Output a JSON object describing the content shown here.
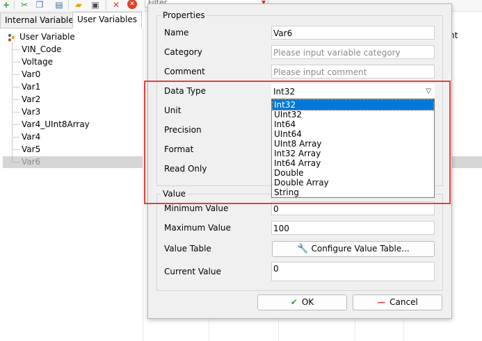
{
  "toolbar": {
    "icons": [
      "add-icon",
      "cut-icon",
      "copy-icon",
      "paste-icon",
      "open-folder-icon",
      "save-icon",
      "delete-icon",
      "stop-icon"
    ],
    "filter_placeholder": "Filter"
  },
  "tabs": [
    {
      "label": "Internal Variables",
      "active": false
    },
    {
      "label": "User Variables",
      "active": true
    }
  ],
  "tree": {
    "root": "User Variable",
    "items": [
      "VIN_Code",
      "Voltage",
      "Var0",
      "Var1",
      "Var2",
      "Var3",
      "Var4_UInt8Array",
      "Var4",
      "Var5",
      "Var6"
    ],
    "selected": "Var6"
  },
  "grid": {
    "header_partial": "nt"
  },
  "dialog": {
    "properties_title": "Properties",
    "name_label": "Name",
    "name_value": "Var6",
    "category_label": "Category",
    "category_placeholder": "Please input variable category",
    "comment_label": "Comment",
    "comment_placeholder": "Please input comment",
    "datatype_label": "Data Type",
    "datatype_value": "Int32",
    "unit_label": "Unit",
    "precision_label": "Precision",
    "format_label": "Format",
    "readonly_label": "Read Only",
    "value_title": "Value",
    "min_label": "Minimum Value",
    "min_value": "0",
    "max_label": "Maximum Value",
    "max_value": "100",
    "valuetable_label": "Value Table",
    "configure_button": "Configure Value Table...",
    "current_label": "Current Value",
    "current_value": "0",
    "ok_button": "OK",
    "cancel_button": "Cancel"
  },
  "dropdown": {
    "options": [
      "Int32",
      "UInt32",
      "Int64",
      "UInt64",
      "UInt8 Array",
      "Int32 Array",
      "Int64 Array",
      "Double",
      "Double Array",
      "String"
    ],
    "highlighted": "Int32"
  },
  "colors": {
    "highlight": "#0078d7",
    "annotation_frame": "#e2403a",
    "ok_check": "#2e9e3a",
    "cancel_dash": "#d9442c",
    "wrench": "#2f6fb6"
  }
}
